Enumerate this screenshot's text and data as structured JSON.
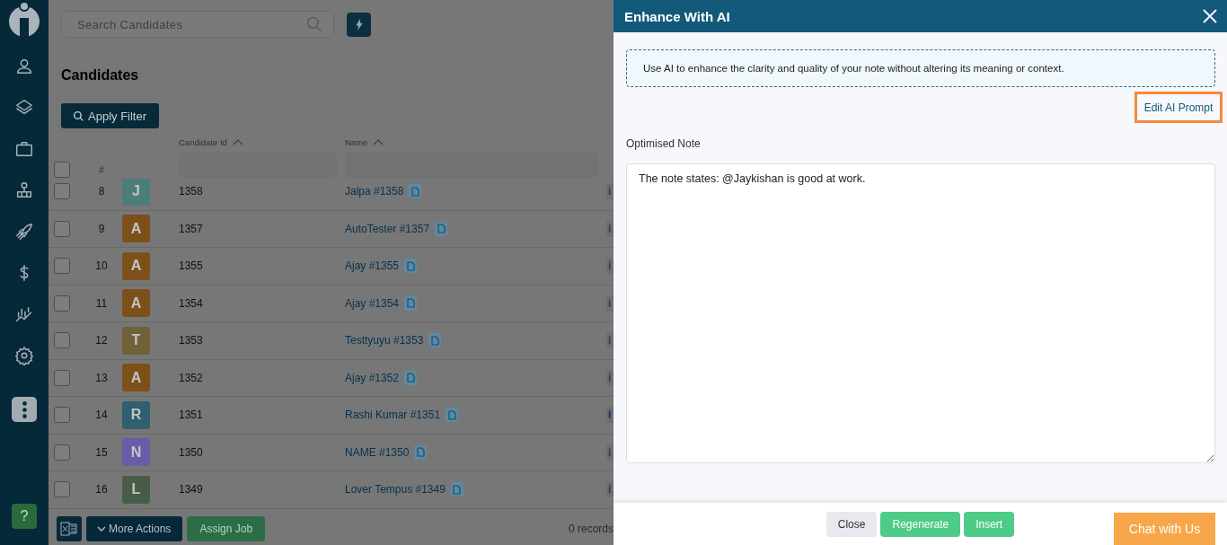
{
  "sidebar": {
    "items": [
      {
        "kind": "person",
        "selected": false
      },
      {
        "kind": "layers",
        "selected": false
      },
      {
        "kind": "briefcase",
        "selected": false
      },
      {
        "kind": "org",
        "selected": false
      },
      {
        "kind": "rocket",
        "selected": false
      },
      {
        "kind": "dollar",
        "selected": false
      },
      {
        "kind": "chart",
        "selected": false
      },
      {
        "kind": "gear",
        "selected": false
      },
      {
        "kind": "more",
        "selected": true
      }
    ],
    "help_button": "?"
  },
  "search": {
    "placeholder": "Search Candidates"
  },
  "page_title": "Candidates",
  "apply_filter_button": "Apply Filter",
  "table": {
    "header_checked": false,
    "columns": [
      {
        "label": "#"
      },
      {
        "label": "Candidate Id",
        "sorted": true
      },
      {
        "label": "Name",
        "sorted": true
      }
    ],
    "rows": [
      {
        "checked": false,
        "number": "8",
        "initial": "J",
        "color": "#4b7e78",
        "candidate_id": "1358",
        "name": "Jalpa #1358",
        "column_4": {
          "text": "i",
          "highlighted": false
        }
      },
      {
        "checked": false,
        "number": "9",
        "initial": "A",
        "color": "#7d5019",
        "candidate_id": "1357",
        "name": "AutoTester #1357",
        "column_4": {
          "text": "i",
          "highlighted": false
        }
      },
      {
        "checked": false,
        "number": "10",
        "initial": "A",
        "color": "#7d5019",
        "candidate_id": "1355",
        "name": "Ajay #1355",
        "column_4": {
          "text": "i",
          "highlighted": false
        }
      },
      {
        "checked": false,
        "number": "11",
        "initial": "A",
        "color": "#7d5019",
        "candidate_id": "1354",
        "name": "Ajay #1354",
        "column_4": {
          "text": "i",
          "highlighted": false
        }
      },
      {
        "checked": false,
        "number": "12",
        "initial": "T",
        "color": "#6f6238",
        "candidate_id": "1353",
        "name": "Testtyuyu #1353",
        "column_4": {
          "text": "i",
          "highlighted": false
        }
      },
      {
        "checked": false,
        "number": "13",
        "initial": "A",
        "color": "#7d5019",
        "candidate_id": "1352",
        "name": "Ajay #1352",
        "column_4": {
          "text": "i",
          "highlighted": false
        }
      },
      {
        "checked": false,
        "number": "14",
        "initial": "R",
        "color": "#2f5f70",
        "candidate_id": "1351",
        "name": "Rashi Kumar #1351",
        "column_4": {
          "text": "i",
          "highlighted": true
        }
      },
      {
        "checked": false,
        "number": "15",
        "initial": "N",
        "color": "#6a5ca8",
        "candidate_id": "1350",
        "name": "NAME #1350",
        "column_4": {
          "text": "i",
          "highlighted": false
        }
      },
      {
        "checked": false,
        "number": "16",
        "initial": "L",
        "color": "#485d47",
        "candidate_id": "1349",
        "name": "Lover Tempus #1349",
        "column_4": {
          "text": "i",
          "highlighted": false
        }
      }
    ]
  },
  "bottom_bar": {
    "more_actions_button": "More Actions",
    "assign_job_button": "Assign Job",
    "records": "0 records"
  },
  "dialog": {
    "title": "Enhance With AI",
    "info": "Use AI to enhance the clarity and quality of your note without altering its meaning or context.",
    "edit_prompt_button": "Edit AI Prompt",
    "note_label": "Optimised Note",
    "note": "The note states: @Jaykishan is good at work.",
    "buttons": [
      {
        "label": "Close",
        "kind": "secondary"
      },
      {
        "label": "Regenerate",
        "kind": "primary"
      },
      {
        "label": "Insert",
        "kind": "primary"
      }
    ]
  },
  "chat_button": "Chat with Us"
}
